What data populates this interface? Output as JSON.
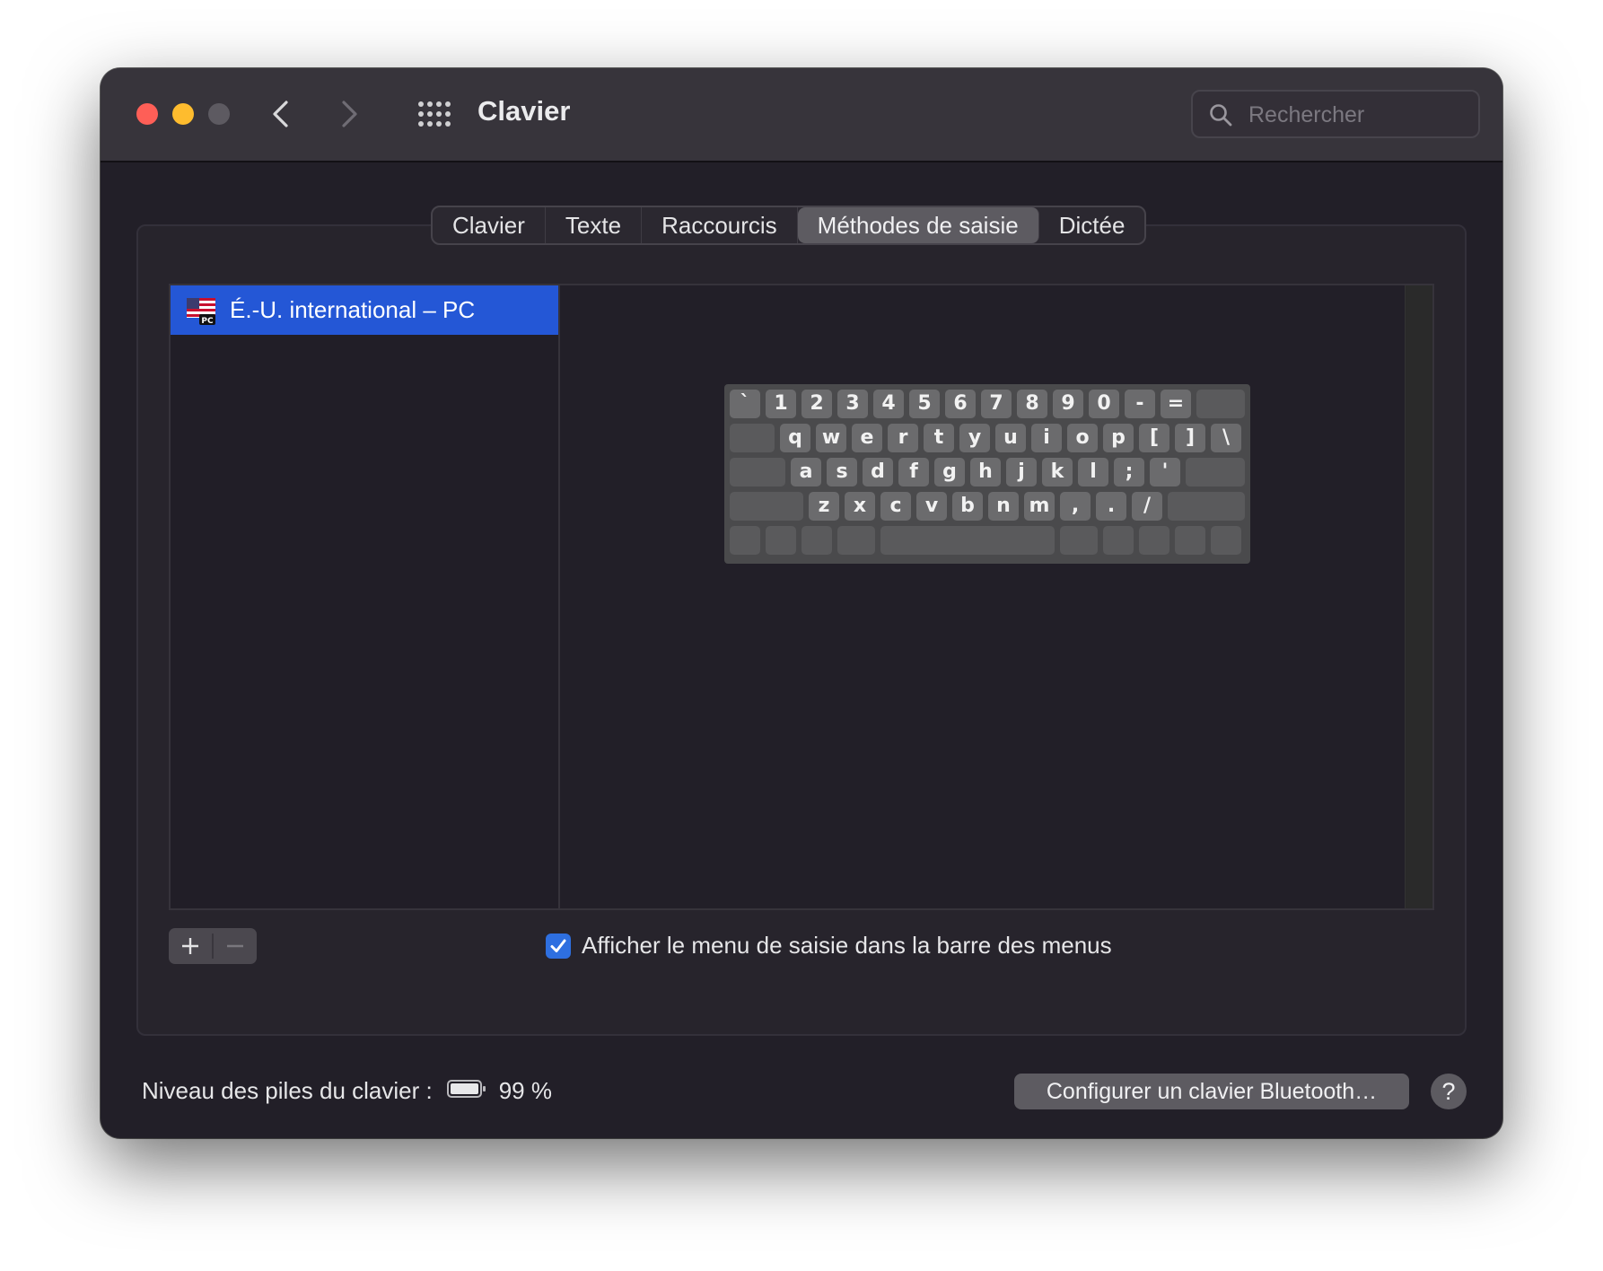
{
  "window": {
    "title": "Clavier",
    "search_placeholder": "Rechercher"
  },
  "tabs": [
    {
      "label": "Clavier"
    },
    {
      "label": "Texte"
    },
    {
      "label": "Raccourcis"
    },
    {
      "label": "Méthodes de saisie",
      "selected": true
    },
    {
      "label": "Dictée"
    }
  ],
  "input_sources": [
    {
      "label": "É.-U. international – PC",
      "icon": "us-flag-pc-icon",
      "selected": true
    }
  ],
  "keyboard_rows": [
    [
      "`",
      "1",
      "2",
      "3",
      "4",
      "5",
      "6",
      "7",
      "8",
      "9",
      "0",
      "-",
      "="
    ],
    [
      "q",
      "w",
      "e",
      "r",
      "t",
      "y",
      "u",
      "i",
      "o",
      "p",
      "[",
      "]",
      "\\"
    ],
    [
      "a",
      "s",
      "d",
      "f",
      "g",
      "h",
      "j",
      "k",
      "l",
      ";",
      "'"
    ],
    [
      "z",
      "x",
      "c",
      "v",
      "b",
      "n",
      "m",
      ",",
      ".",
      "/"
    ]
  ],
  "buttons": {
    "add": "+",
    "remove": "—"
  },
  "show_menu_checkbox": {
    "label": "Afficher le menu de saisie dans la barre des menus",
    "checked": true
  },
  "battery": {
    "label": "Niveau des piles du clavier :",
    "level_text": "99 %",
    "level": 0.99
  },
  "bluetooth_button": "Configurer un clavier Bluetooth…",
  "help_button": "?",
  "colors": {
    "accent": "#2457d6",
    "close": "#fe5f57",
    "minimize": "#febc2e"
  }
}
